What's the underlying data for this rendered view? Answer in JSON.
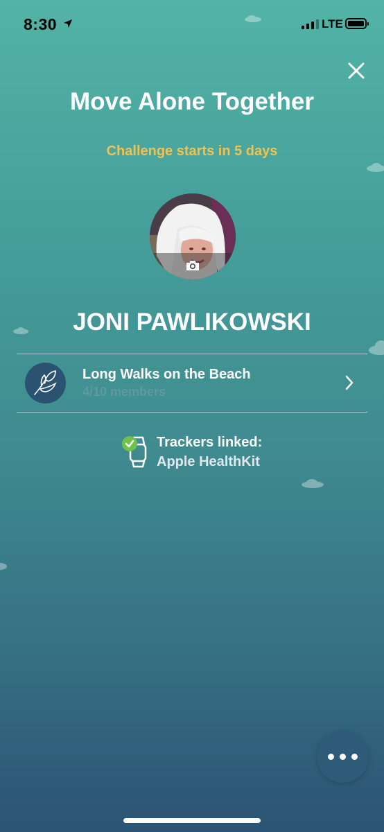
{
  "status_bar": {
    "time": "8:30",
    "network": "LTE"
  },
  "header": {
    "title": "Move Alone Together",
    "countdown": "Challenge starts in 5 days"
  },
  "profile": {
    "name": "JONI PAWLIKOWSKI",
    "avatar_icon": "camera-icon"
  },
  "team": {
    "name": "Long Walks on the Beach",
    "members": "4/10 members",
    "icon": "leaf-icon"
  },
  "trackers": {
    "label": "Trackers linked:",
    "value": "Apple HealthKit",
    "icon": "watch-check-icon"
  },
  "colors": {
    "accent": "#f2c14e",
    "team_icon_bg": "#2c5272",
    "check_green": "#6cc24a",
    "background_top": "#53b3a6",
    "background_bottom": "#2c5373"
  }
}
